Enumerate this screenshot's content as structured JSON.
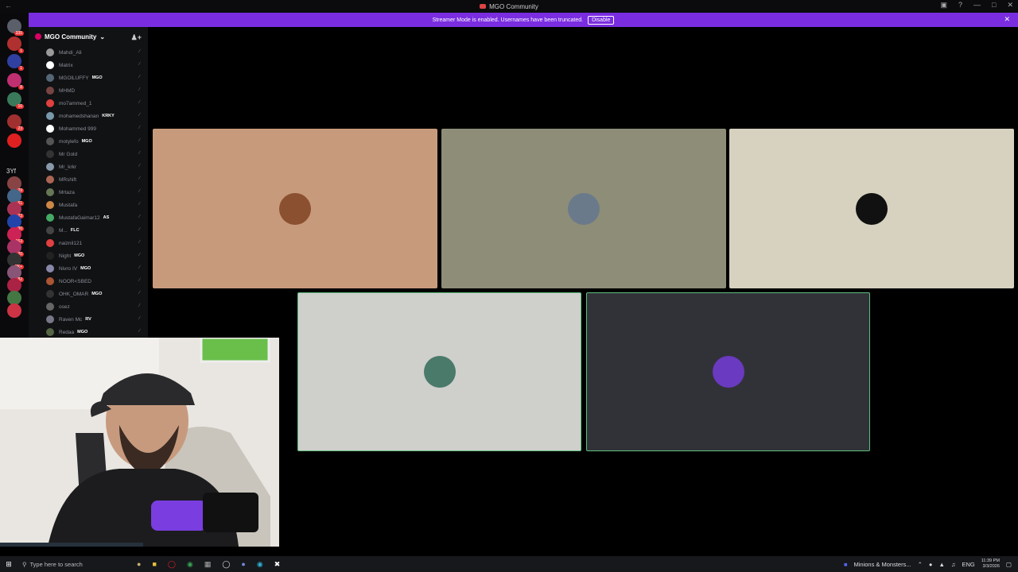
{
  "window": {
    "title": "MGO Community"
  },
  "banner": {
    "text": "Streamer Mode is enabled. Usernames have been truncated.",
    "button": "Disable"
  },
  "server_rail": {
    "text_item": "3Yf",
    "badges": [
      "335",
      "1",
      "1",
      "8",
      "16",
      "23",
      "29",
      "61",
      "23",
      "30",
      "163",
      "20",
      "3K+",
      "82"
    ]
  },
  "server": {
    "name": "MGO Community"
  },
  "members": [
    {
      "name": "Mahdi_Ali",
      "tag": "",
      "color": "#9a9a9a"
    },
    {
      "name": "Matrix",
      "tag": "",
      "color": "#ffffff"
    },
    {
      "name": "MGOlLUFFY",
      "tag": "MGO",
      "color": "#556677"
    },
    {
      "name": "MHMD",
      "tag": "",
      "color": "#774444"
    },
    {
      "name": "mo7ammed_1",
      "tag": "",
      "color": "#e04040"
    },
    {
      "name": "mohamedshanan",
      "tag": "KRKY",
      "color": "#7799aa"
    },
    {
      "name": "Mohammed 999",
      "tag": "",
      "color": "#ffffff"
    },
    {
      "name": "motylefo",
      "tag": "MGO",
      "color": "#555555"
    },
    {
      "name": "Mr Gold",
      "tag": "",
      "color": "#333333"
    },
    {
      "name": "Mr_krkr",
      "tag": "",
      "color": "#8899aa"
    },
    {
      "name": "MRshift",
      "tag": "",
      "color": "#aa6655"
    },
    {
      "name": "Mrtaza",
      "tag": "",
      "color": "#667755"
    },
    {
      "name": "Mustafa",
      "tag": "",
      "color": "#cc8844"
    },
    {
      "name": "MustafaGaimar12",
      "tag": "AS",
      "color": "#44aa66"
    },
    {
      "name": "M...",
      "tag": "FLC",
      "color": "#444444"
    },
    {
      "name": "naiznil121",
      "tag": "",
      "color": "#e04040"
    },
    {
      "name": "Night",
      "tag": "MGO",
      "color": "#222222"
    },
    {
      "name": "Nivro IV",
      "tag": "MGO",
      "color": "#8888aa"
    },
    {
      "name": "NOOR<SBED",
      "tag": "",
      "color": "#aa5533"
    },
    {
      "name": "OHK_OMAR",
      "tag": "MGO",
      "color": "#333333"
    },
    {
      "name": "osez",
      "tag": "",
      "color": "#666666"
    },
    {
      "name": "Raven Mc",
      "tag": "RV",
      "color": "#777788"
    },
    {
      "name": "Redaa",
      "tag": "MGO",
      "color": "#556644"
    }
  ],
  "tiles": [
    {
      "bg": "#c89a7c",
      "avatar": "#8a5030",
      "speaking": false
    },
    {
      "bg": "#8e8d78",
      "avatar": "#6a7a8a",
      "speaking": false
    },
    {
      "bg": "#d6d2bf",
      "avatar": "#111111",
      "speaking": false
    },
    {
      "bg": "#cfcfcc",
      "avatar": "#4a7a6a",
      "speaking": true
    },
    {
      "bg": "#313238",
      "avatar": "#6a3ac0",
      "speaking": true
    }
  ],
  "taskbar": {
    "search_placeholder": "Type here to search",
    "now_playing": "Minions & Monsters...",
    "lang": "ENG",
    "time": "11:39 PM",
    "date": "3/3/2026"
  }
}
